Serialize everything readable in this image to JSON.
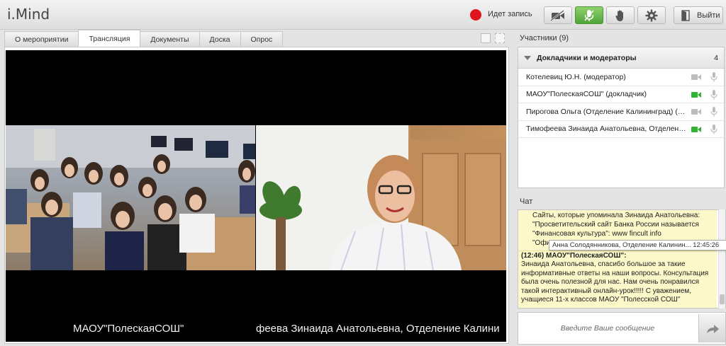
{
  "app": {
    "title": "i.Mind"
  },
  "recording": {
    "label": "Идет запись",
    "color": "#e0141b"
  },
  "toolbar": {
    "buttons": [
      {
        "icon": "camera-off-icon"
      },
      {
        "icon": "microphone-icon",
        "active": true
      },
      {
        "icon": "hand-raise-icon"
      },
      {
        "icon": "gear-icon"
      }
    ],
    "exit_label": "Выйти"
  },
  "tabs": [
    {
      "label": "О мероприятии"
    },
    {
      "label": "Трансляция",
      "active": true
    },
    {
      "label": "Документы"
    },
    {
      "label": "Доска"
    },
    {
      "label": "Опрос"
    }
  ],
  "videos": {
    "left_caption": "МАОУ\"ПолескаяСОШ\"",
    "right_caption": "феева Зинаида Анатольевна, Отделение Калини"
  },
  "participants": {
    "title": "Участники (9)",
    "group": {
      "label": "Докладчики и модераторы",
      "count": "4"
    },
    "rows": [
      {
        "name": "Котелевиц Ю.Н. (модератор)",
        "cam_on": false
      },
      {
        "name": "МАОУ\"ПолескаяСОШ\" (докладчик)",
        "cam_on": true
      },
      {
        "name": "Пирогова Ольга (Отделение Калининград) (до...",
        "cam_on": false
      },
      {
        "name": "Тимофеева Зинаида Анатольевна, Отделение ...",
        "cam_on": true
      }
    ]
  },
  "chat": {
    "title": "Чат",
    "message1_lines": [
      "Сайты, которые упоминала Зинаида Анатольевна:",
      "\"Просветительский сайт Банка России называется",
      "\"Финансовая культура\": www fincult info",
      "\"Офи"
    ],
    "tooltip": "Анна Солодянникова, Отделение Калинин... 12:45:26",
    "message2": {
      "header": "(12:46) МАОУ\"ПолескаяСОШ\":",
      "text": "Зинаида Анатольевна, спасибо большое за такие информативные ответы на наши вопросы. Консультация была очень полезной для нас. Нам очень понравился такой интерактивный онлайн-урок!!!!! С уважением, учащиеся 11-х классов МАОУ \"Полесской СОШ\""
    },
    "input_placeholder": "Введите Ваше сообщение"
  },
  "colors": {
    "accent_green": "#4fa33a",
    "cam_on": "#33b233",
    "icon_gray": "#bdbdbd"
  }
}
